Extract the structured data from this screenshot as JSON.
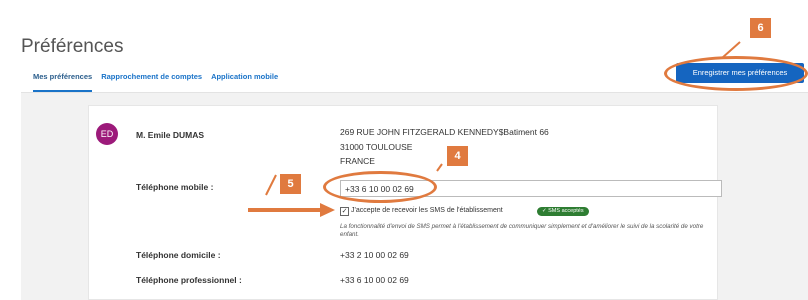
{
  "header": {
    "title": "Préférences",
    "tabs": [
      {
        "label": "Mes préférences"
      },
      {
        "label": "Rapprochement de comptes"
      },
      {
        "label": "Application mobile"
      }
    ],
    "save_label": "Enregistrer mes préférences"
  },
  "profile": {
    "initials": "ED",
    "name": "M. Emile DUMAS",
    "address": [
      "269 RUE JOHN FITZGERALD KENNEDY$Batiment 66",
      "31000 TOULOUSE",
      "FRANCE"
    ],
    "avatar_color": "#9c1a7a"
  },
  "mobile": {
    "label": "Téléphone mobile :",
    "value": "+33 6 10 00 02 69",
    "consent": "J'accepte de recevoir les SMS de l'établissement",
    "consent_checked": true,
    "badge": "SMS acceptés",
    "info": "La fonctionnalité d'envoi de SMS permet à l'établissement de communiquer simplement et d'améliorer le suivi de la scolarité de votre enfant."
  },
  "home_phone": {
    "label": "Téléphone domicile :",
    "value": "+33 2 10 00 02 69"
  },
  "work_phone": {
    "label": "Téléphone professionnel :",
    "value": "+33 6 10 00 02 69"
  },
  "annotations": {
    "callouts": [
      "4",
      "5",
      "6"
    ],
    "color": "#e07a3f"
  },
  "colors": {
    "accent": "#1565c0",
    "success": "#2e7d32"
  }
}
